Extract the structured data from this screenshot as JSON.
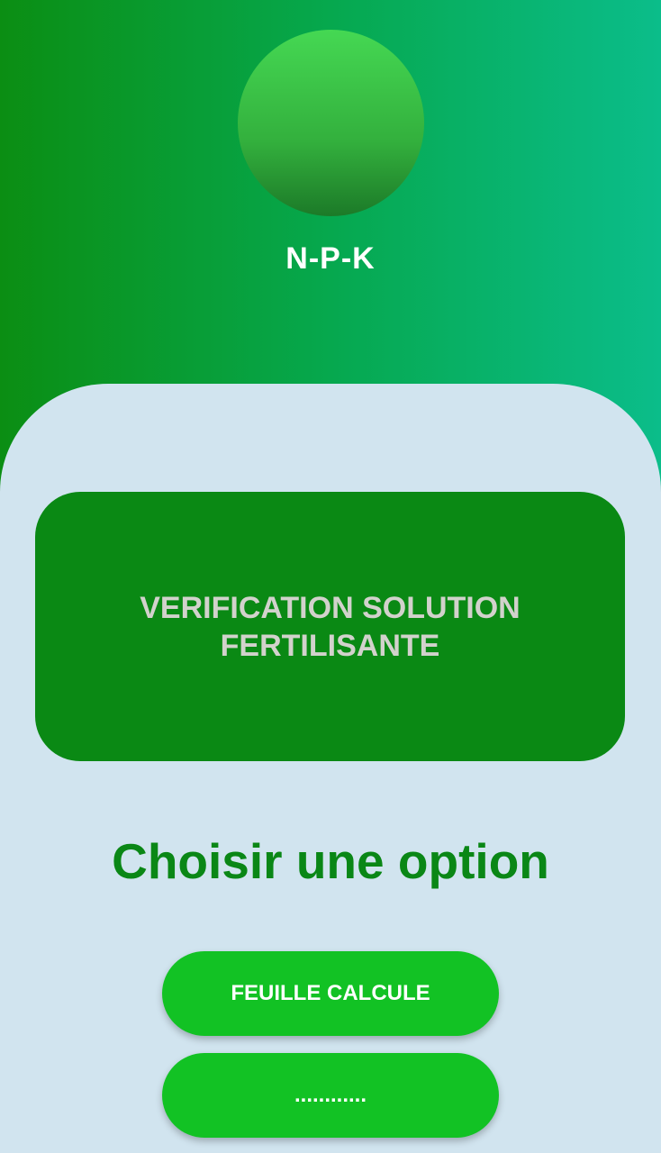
{
  "header": {
    "app_title": "N-P-K",
    "logo_icon": "green-circle-logo-icon"
  },
  "hero_card": {
    "label": "VERIFICATION SOLUTION FERTILISANTE"
  },
  "options": {
    "title": "Choisir une option",
    "buttons": [
      {
        "label": "FEUILLE CALCULE"
      },
      {
        "label": "............"
      }
    ]
  },
  "colors": {
    "header_gradient_start": "#0b8e13",
    "header_gradient_end": "#0bbd8a",
    "panel_background": "#d1e4ef",
    "card_green": "#0a8914",
    "title_green": "#0a8716",
    "button_green": "#12c224"
  }
}
